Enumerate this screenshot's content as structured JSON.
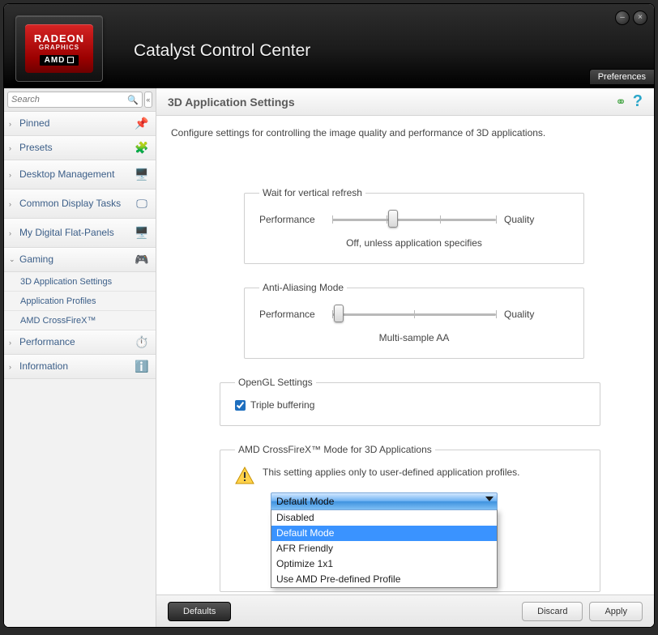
{
  "window": {
    "app_title": "Catalyst Control Center",
    "logo_line1": "RADEON",
    "logo_line2": "GRAPHICS",
    "logo_brand": "AMD",
    "preferences": "Preferences"
  },
  "sidebar": {
    "search_placeholder": "Search",
    "items": [
      {
        "label": "Pinned",
        "caret": "›",
        "icon": "📌",
        "icon_name": "pin-icon"
      },
      {
        "label": "Presets",
        "caret": "›",
        "icon": "🧩",
        "icon_name": "presets-icon"
      },
      {
        "label": "Desktop Management",
        "caret": "›",
        "icon": "🖥️",
        "icon_name": "desktop-icon",
        "tall": true
      },
      {
        "label": "Common Display Tasks",
        "caret": "›",
        "icon": "🖵",
        "icon_name": "display-icon",
        "tall": true
      },
      {
        "label": "My Digital Flat-Panels",
        "caret": "›",
        "icon": "🖥️",
        "icon_name": "monitor-icon",
        "tall": true
      },
      {
        "label": "Gaming",
        "caret": "⌄",
        "icon": "🎮",
        "icon_name": "gamepad-icon"
      }
    ],
    "gaming_sub": [
      "3D Application Settings",
      "Application Profiles",
      "AMD CrossFireX™"
    ],
    "items_after": [
      {
        "label": "Performance",
        "caret": "›",
        "icon": "⏱️",
        "icon_name": "gauge-icon"
      },
      {
        "label": "Information",
        "caret": "›",
        "icon": "ℹ️",
        "icon_name": "info-icon"
      }
    ]
  },
  "main": {
    "title": "3D Application Settings",
    "intro": "Configure settings for controlling the image quality and performance of 3D applications.",
    "vsync": {
      "legend": "Wait for vertical refresh",
      "left": "Performance",
      "right": "Quality",
      "status": "Off, unless application specifies",
      "thumb_pct": 37
    },
    "aa": {
      "legend": "Anti-Aliasing Mode",
      "left": "Performance",
      "right": "Quality",
      "status": "Multi-sample AA",
      "thumb_pct": 4
    },
    "ogl": {
      "legend": "OpenGL Settings",
      "triple": "Triple buffering",
      "checked": true
    },
    "cfx": {
      "legend": "AMD CrossFireX™ Mode for 3D Applications",
      "warn": "This setting applies only to user-defined application profiles.",
      "selected": "Default Mode",
      "options": [
        "Disabled",
        "Default Mode",
        "AFR Friendly",
        "Optimize 1x1",
        "Use AMD Pre-defined Profile"
      ]
    }
  },
  "footer": {
    "defaults": "Defaults",
    "discard": "Discard",
    "apply": "Apply"
  }
}
